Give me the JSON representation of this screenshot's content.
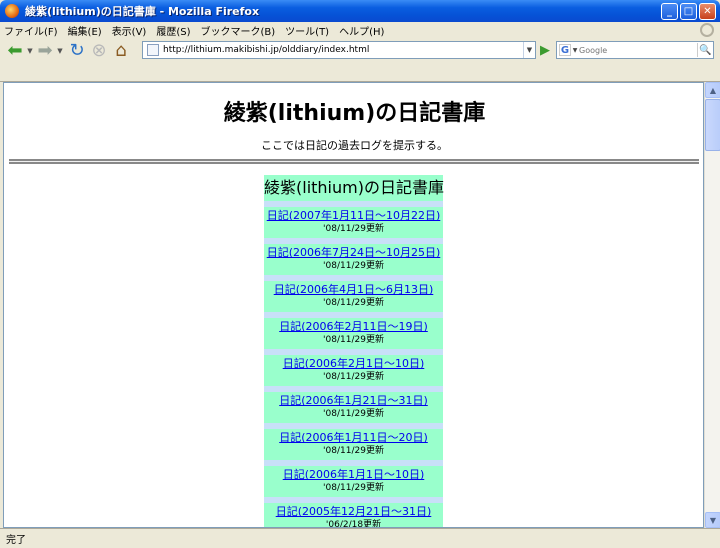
{
  "window": {
    "title": "綾紫(lithium)の日記書庫 - Mozilla Firefox"
  },
  "menu": [
    "ファイル(F)",
    "編集(E)",
    "表示(V)",
    "履歴(S)",
    "ブックマーク(B)",
    "ツール(T)",
    "ヘルプ(H)"
  ],
  "toolbar": {
    "url": "http://lithium.makibishi.jp/olddiary/index.html",
    "search_placeholder": "Google",
    "search_engine_icon": "G"
  },
  "page": {
    "title": "綾紫(lithium)の日記書庫",
    "subtitle": "ここでは日記の過去ログを提示する。",
    "table_heading": "綾紫(lithium)の日記書庫",
    "entries": [
      {
        "link": "日記(2007年1月11日～10月22日)",
        "updated": "'08/11/29更新"
      },
      {
        "link": "日記(2006年7月24日～10月25日)",
        "updated": "'08/11/29更新"
      },
      {
        "link": "日記(2006年4月1日～6月13日)",
        "updated": "'08/11/29更新"
      },
      {
        "link": "日記(2006年2月11日～19日)",
        "updated": "'08/11/29更新"
      },
      {
        "link": "日記(2006年2月1日～10日)",
        "updated": "'08/11/29更新"
      },
      {
        "link": "日記(2006年1月21日～31日)",
        "updated": "'08/11/29更新"
      },
      {
        "link": "日記(2006年1月11日～20日)",
        "updated": "'08/11/29更新"
      },
      {
        "link": "日記(2006年1月1日～10日)",
        "updated": "'08/11/29更新"
      },
      {
        "link": "日記(2005年12月21日～31日)",
        "updated": "'06/2/18更新"
      }
    ]
  },
  "status": {
    "text": "完了"
  }
}
